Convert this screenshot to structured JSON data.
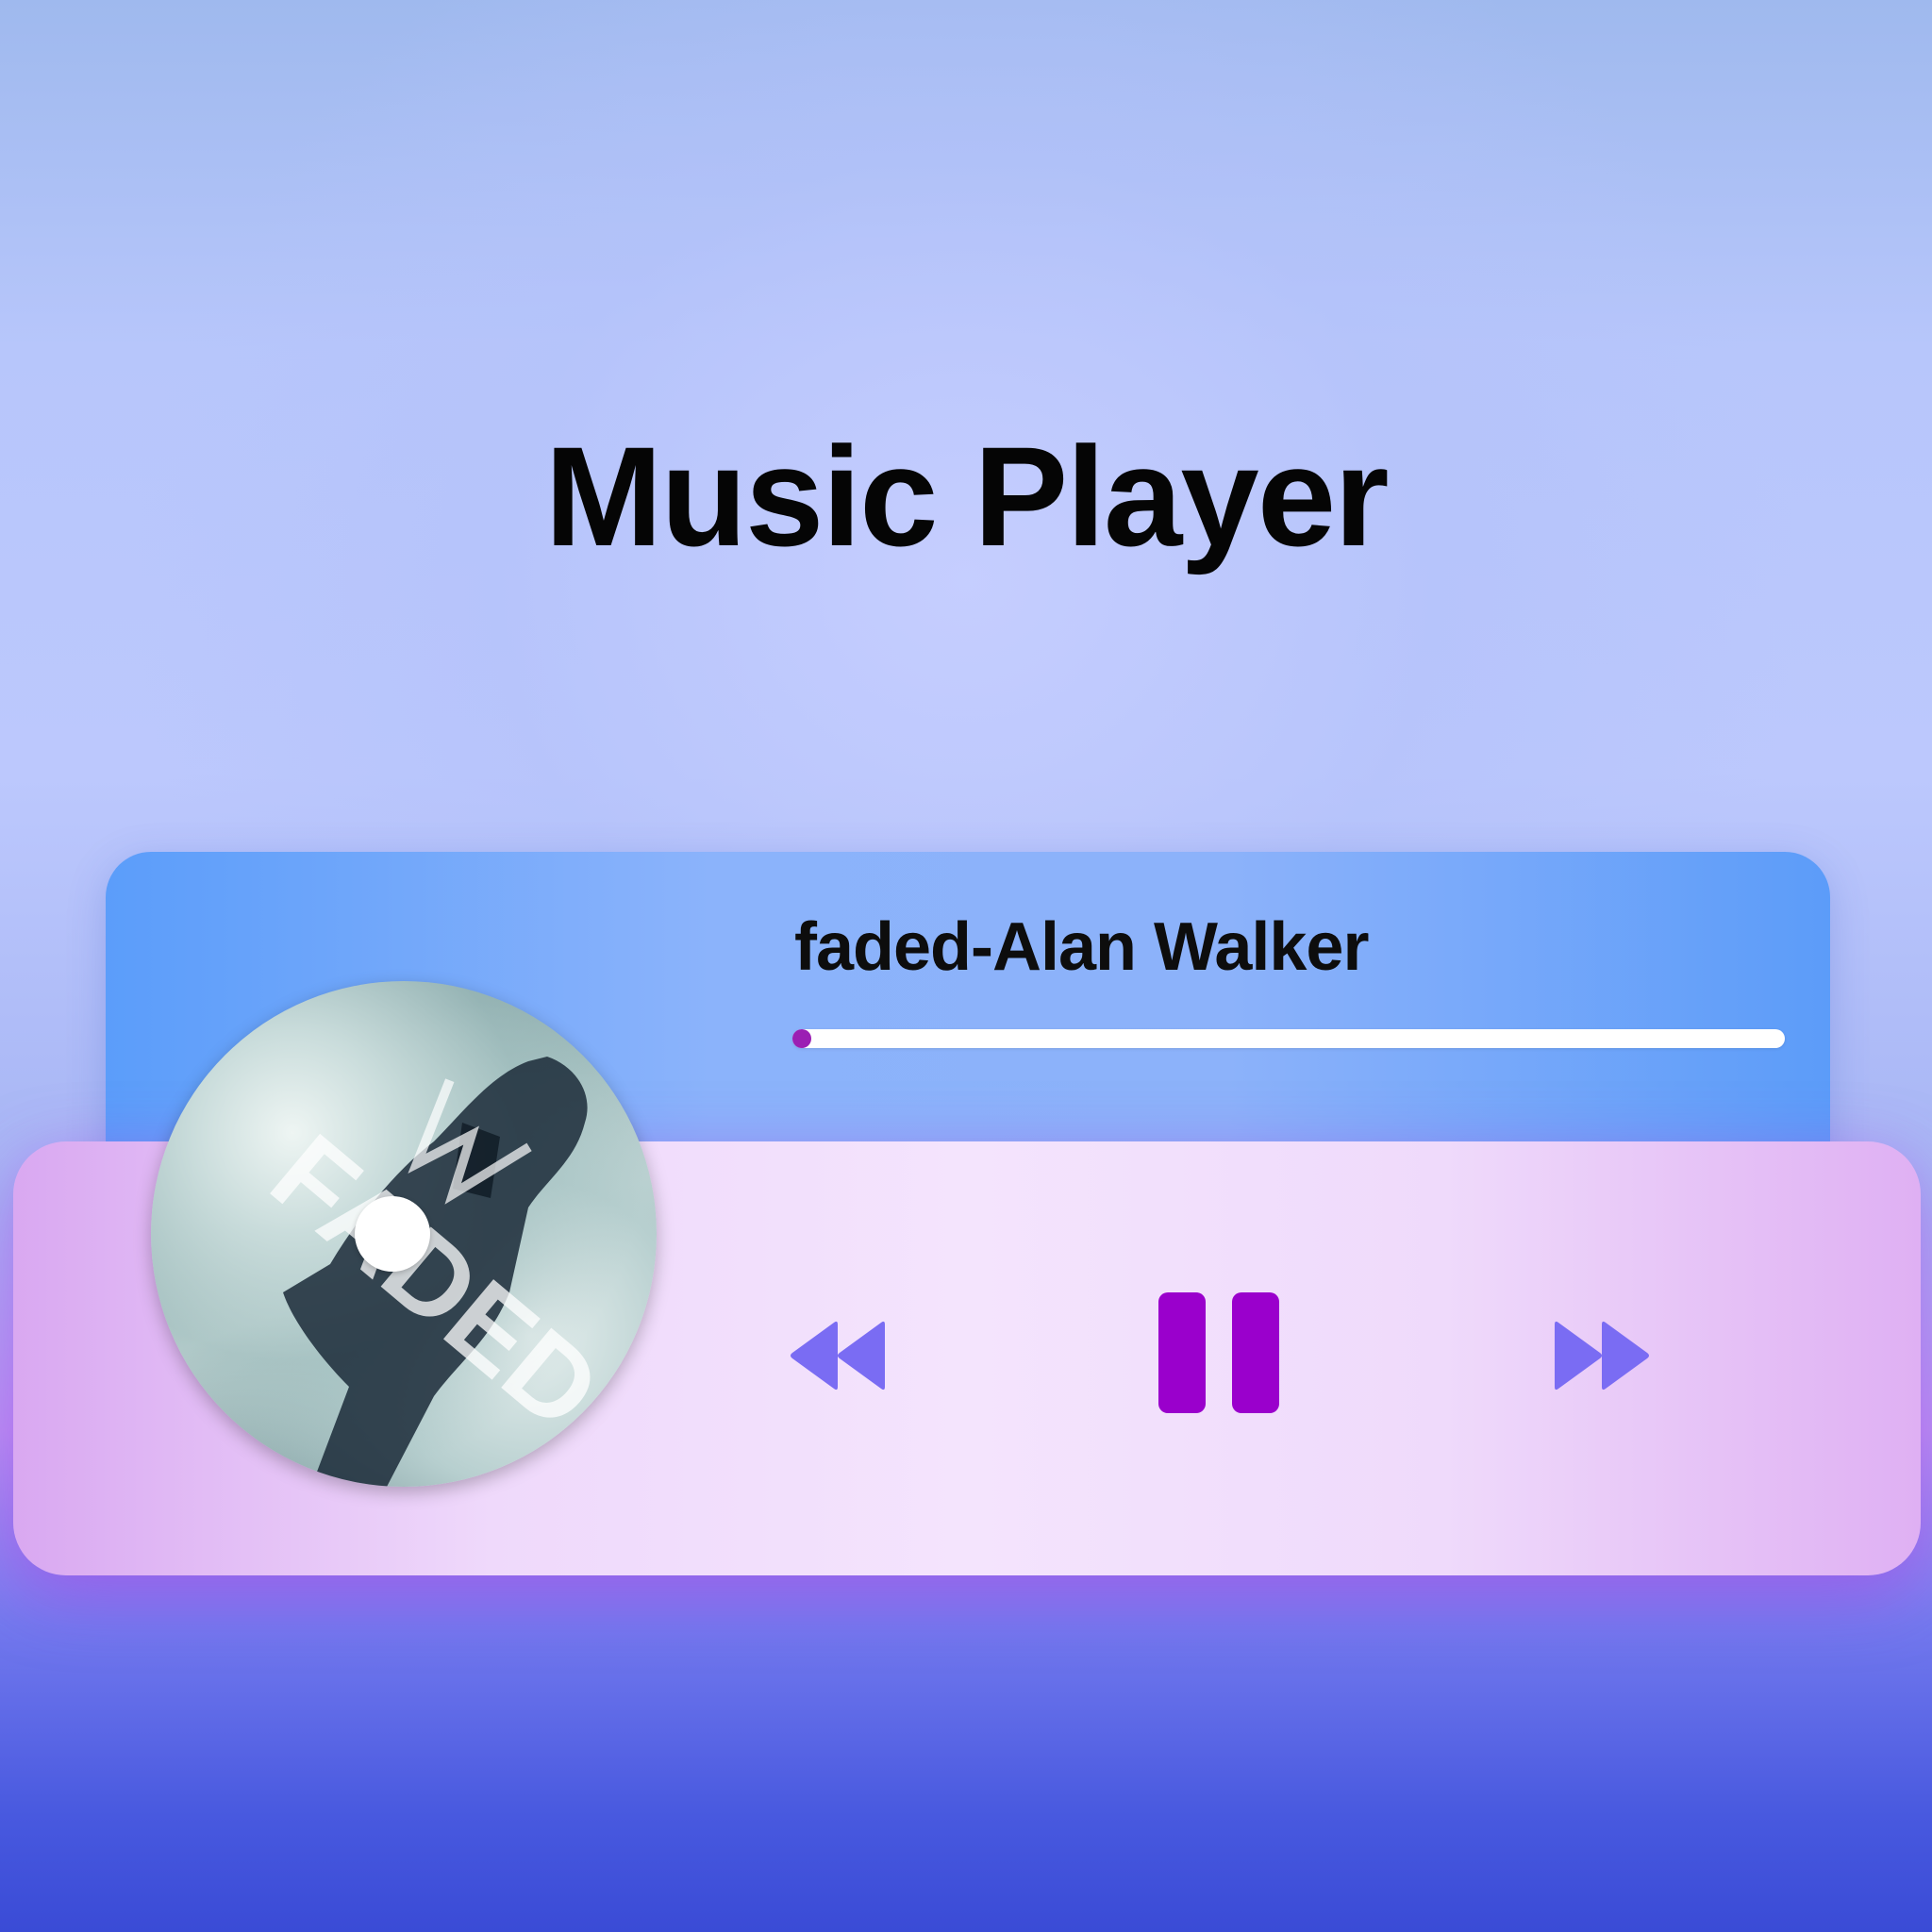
{
  "header": {
    "title": "Music Player"
  },
  "player": {
    "song_title": "faded-Alan Walker",
    "progress_fraction": 0.008,
    "album_art_text": "FADED"
  },
  "controls": {
    "prev_icon": "rewind-icon",
    "play_pause_icon": "pause-icon",
    "next_icon": "fast-forward-icon"
  },
  "colors": {
    "progress_fill": "#9b1fb3",
    "pause_button": "#9a00cc",
    "skip_buttons": "#7a6cf3"
  }
}
